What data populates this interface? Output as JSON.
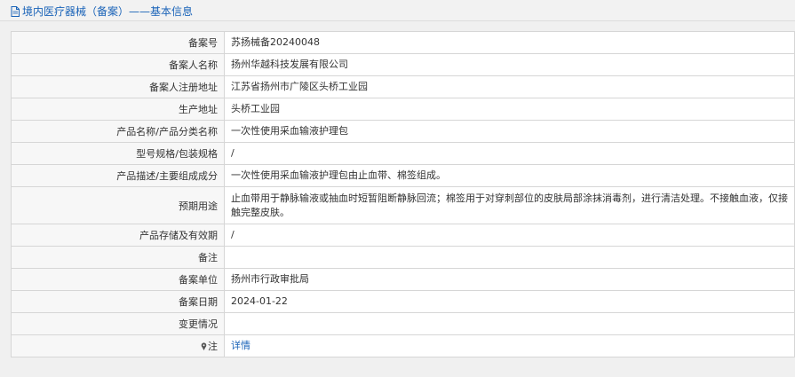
{
  "header": {
    "title": "境内医疗器械（备案）——基本信息",
    "icon": "document-icon",
    "color": "#1a63b8"
  },
  "rows": [
    {
      "label": "备案号",
      "value": "苏扬械备20240048"
    },
    {
      "label": "备案人名称",
      "value": "扬州华越科技发展有限公司"
    },
    {
      "label": "备案人注册地址",
      "value": "江苏省扬州市广陵区头桥工业园"
    },
    {
      "label": "生产地址",
      "value": "头桥工业园"
    },
    {
      "label": "产品名称/产品分类名称",
      "value": "一次性使用采血输液护理包"
    },
    {
      "label": "型号规格/包装规格",
      "value": "/"
    },
    {
      "label": "产品描述/主要组成成分",
      "value": "一次性使用采血输液护理包由止血带、棉签组成。"
    },
    {
      "label": "预期用途",
      "value": "止血带用于静脉输液或抽血时短暂阻断静脉回流；棉签用于对穿刺部位的皮肤局部涂抹消毒剂，进行清洁处理。不接触血液，仅接触完整皮肤。"
    },
    {
      "label": "产品存储及有效期",
      "value": "/"
    },
    {
      "label": "备注",
      "value": ""
    },
    {
      "label": "备案单位",
      "value": "扬州市行政审批局"
    },
    {
      "label": "备案日期",
      "value": "2024-01-22"
    },
    {
      "label": "变更情况",
      "value": ""
    }
  ],
  "note": {
    "label": "注",
    "icon": "pin-icon",
    "link_text": "详情"
  }
}
